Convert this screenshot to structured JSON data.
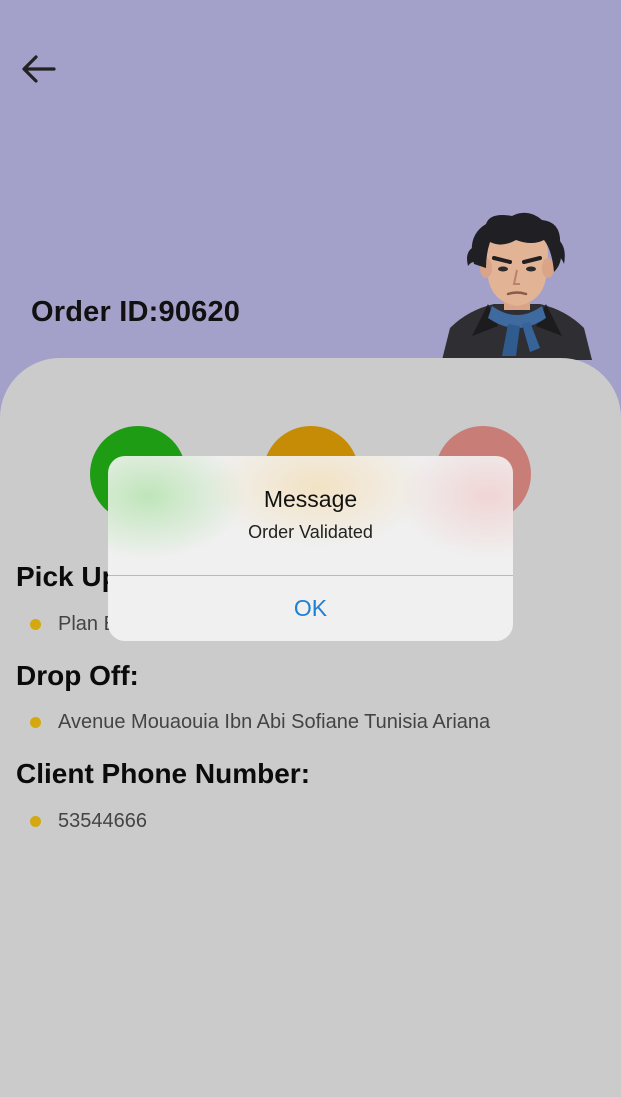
{
  "header": {
    "order_label": "Order ID:90620",
    "back_icon": "arrow-left-icon",
    "avatar_icon": "person-avatar-icon"
  },
  "status_indicators": [
    {
      "name": "green",
      "color": "#1e9d14"
    },
    {
      "name": "orange",
      "color": "#c78c06"
    },
    {
      "name": "red",
      "color": "#c97d77"
    }
  ],
  "details": {
    "pickup_title": "Pick Up:",
    "pickup_value": "Plan B",
    "dropoff_title": "Drop Off:",
    "dropoff_value": "Avenue Mouaouia Ibn Abi Sofiane Tunisia Ariana",
    "phone_title": "Client Phone Number:",
    "phone_value": "53544666"
  },
  "dialog": {
    "title": "Message",
    "message": "Order Validated",
    "ok_label": "OK"
  },
  "colors": {
    "header_bg": "#a3a1c9",
    "sheet_bg": "#cbcbcb",
    "bullet": "#d4a90f",
    "link": "#1f7fd6"
  }
}
